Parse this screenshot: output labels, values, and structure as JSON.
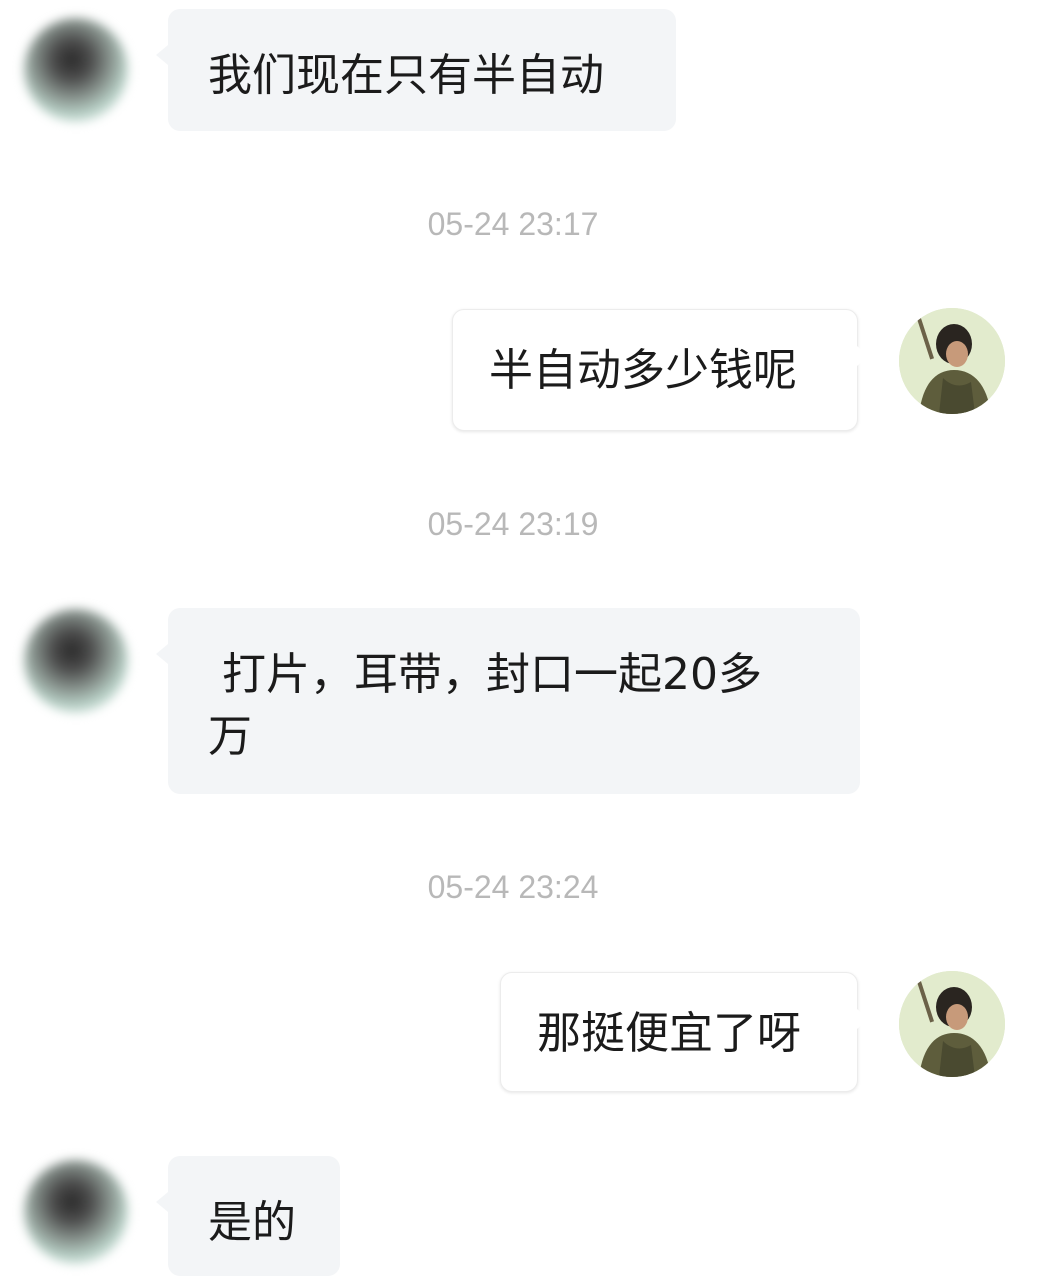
{
  "messages": [
    {
      "sender": "other",
      "text": "我们现在只有半自动",
      "avatar": "blurred-avatar"
    },
    {
      "timestamp": "05-24 23:17"
    },
    {
      "sender": "self",
      "text": "半自动多少钱呢",
      "avatar": "portrait-avatar"
    },
    {
      "timestamp": "05-24 23:19"
    },
    {
      "sender": "other",
      "line1": " 打片，耳带，封口一起20多",
      "line2": "万",
      "avatar": "blurred-avatar"
    },
    {
      "timestamp": "05-24 23:24"
    },
    {
      "sender": "self",
      "text": "那挺便宜了呀",
      "avatar": "portrait-avatar"
    },
    {
      "sender": "other",
      "text": "是的",
      "avatar": "blurred-avatar"
    }
  ],
  "colors": {
    "other_bubble": "#f3f5f7",
    "self_bubble": "#ffffff",
    "timestamp_text": "#b8b8b8",
    "message_text": "#1b1b1b"
  }
}
